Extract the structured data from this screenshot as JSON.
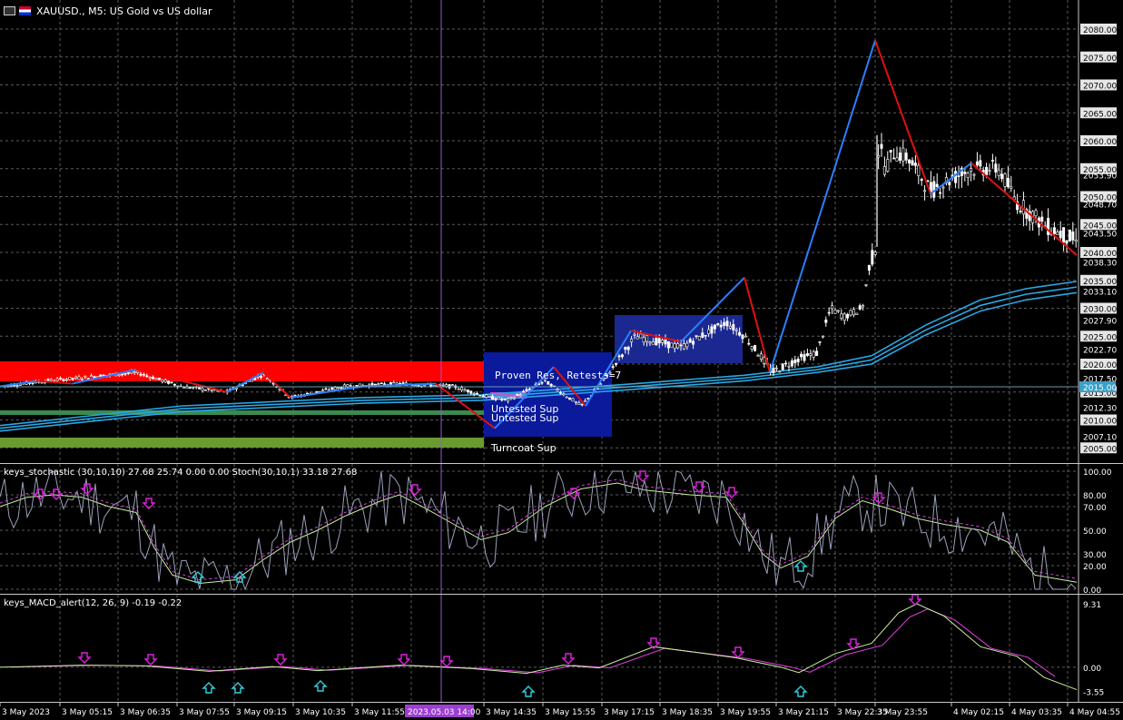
{
  "title": "XAUUSD., M5:  US Gold vs US dollar",
  "main": {
    "price_ticks": [
      "2080.00",
      "2075.00",
      "2070.00",
      "2065.00",
      "2060.00",
      "2055.00",
      "2050.00",
      "2045.00",
      "2040.00",
      "2035.00",
      "2030.00",
      "2025.00",
      "2020.00",
      "2015.00",
      "2010.00",
      "2005.00"
    ],
    "extra_price_labels": [
      "2053.90",
      "2048.70",
      "2043.50",
      "2038.30",
      "2033.10",
      "2027.90",
      "2022.70",
      "2017.50",
      "2012.30",
      "2007.10"
    ],
    "current_price": "2015.00",
    "zones": {
      "proven_res": "Proven Res, Retests=7",
      "untested_sup_1": "Untested Sup",
      "untested_sup_2": "Untested Sup",
      "turncoat_sup": "Turncoat Sup"
    },
    "colors": {
      "bull": "#2a7fff",
      "bear": "#e01010",
      "resistance": "#ff0000",
      "support": "#4a8a3a",
      "zone_box": "#0a1a9a",
      "ma": "#29a8e6"
    }
  },
  "stoch": {
    "label": "keys_stochastic (30,10,10) 27.68 25.74 0.00 0.00 Stoch(30,10,1) 33.18 27.68",
    "ticks": [
      "100.00",
      "80.00",
      "70.00",
      "50.00",
      "30.00",
      "20.00",
      "0.00"
    ]
  },
  "macd": {
    "label": "keys_MACD_alert(12, 26, 9) -0.19 -0.22",
    "ticks": [
      "9.31",
      "0.00",
      "-3.55"
    ]
  },
  "time_axis": {
    "labels": [
      "3 May 2023",
      "3 May 05:15",
      "3 May 06:35",
      "3 May 07:55",
      "3 May 09:15",
      "3 May 10:35",
      "3 May 11:55",
      "",
      "3 May 14:35",
      "3 May 15:55",
      "3 May 17:15",
      "3 May 18:35",
      "3 May 19:55",
      "3 May 21:15",
      "3 May 22:35",
      "3 May 23:55",
      "4 May 02:15",
      "4 May 03:35",
      "4 May 04:55"
    ],
    "crosshair_time": "2023.05.03 14:00"
  }
}
